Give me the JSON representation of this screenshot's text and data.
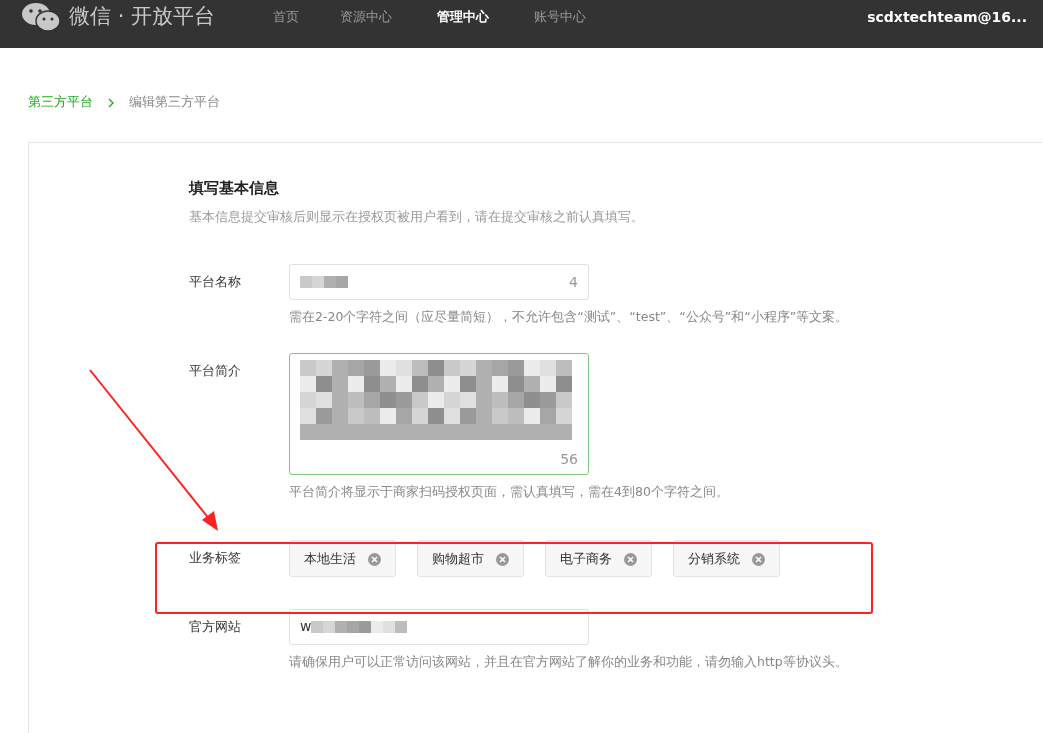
{
  "header": {
    "logo_text": "微信 · 开放平台",
    "nav": [
      {
        "label": "首页",
        "selected": false
      },
      {
        "label": "资源中心",
        "selected": false
      },
      {
        "label": "管理中心",
        "selected": true
      },
      {
        "label": "账号中心",
        "selected": false
      }
    ],
    "account": "scdxtechteam@16..."
  },
  "breadcrumb": [
    {
      "label": "第三方平台",
      "kind": "link"
    },
    {
      "label": "编辑第三方平台",
      "kind": "current"
    }
  ],
  "section": {
    "title": "填写基本信息",
    "description": "基本信息提交审核后则显示在授权页被用户看到，请在提交审核之前认真填写。"
  },
  "fields": [
    {
      "kind": "text",
      "label": "平台名称",
      "redacted": true,
      "count": "4",
      "hint": "需在2-20个字符之间（应尽量简短），不允许包含“测试”、“test”、“公众号”和“小程序”等文案。",
      "focused": false
    },
    {
      "kind": "textarea",
      "label": "平台简介",
      "redacted": true,
      "count": "56",
      "hint": "平台简介将显示于商家扫码授权页面，需认真填写，需在4到80个字符之间。",
      "focused": true
    },
    {
      "kind": "tags",
      "label": "业务标签",
      "tags": [
        "本地生活",
        "购物超市",
        "电子商务",
        "分销系统"
      ]
    },
    {
      "kind": "text",
      "label": "官方网站",
      "value": "w",
      "redacted": true,
      "hint": "请确保用户可以正常访问该网站，并且在官方网站了解你的业务和功能，请勿输入http等协议头。",
      "focused": false
    }
  ],
  "arrow_annotation": true,
  "highlight_box": true
}
